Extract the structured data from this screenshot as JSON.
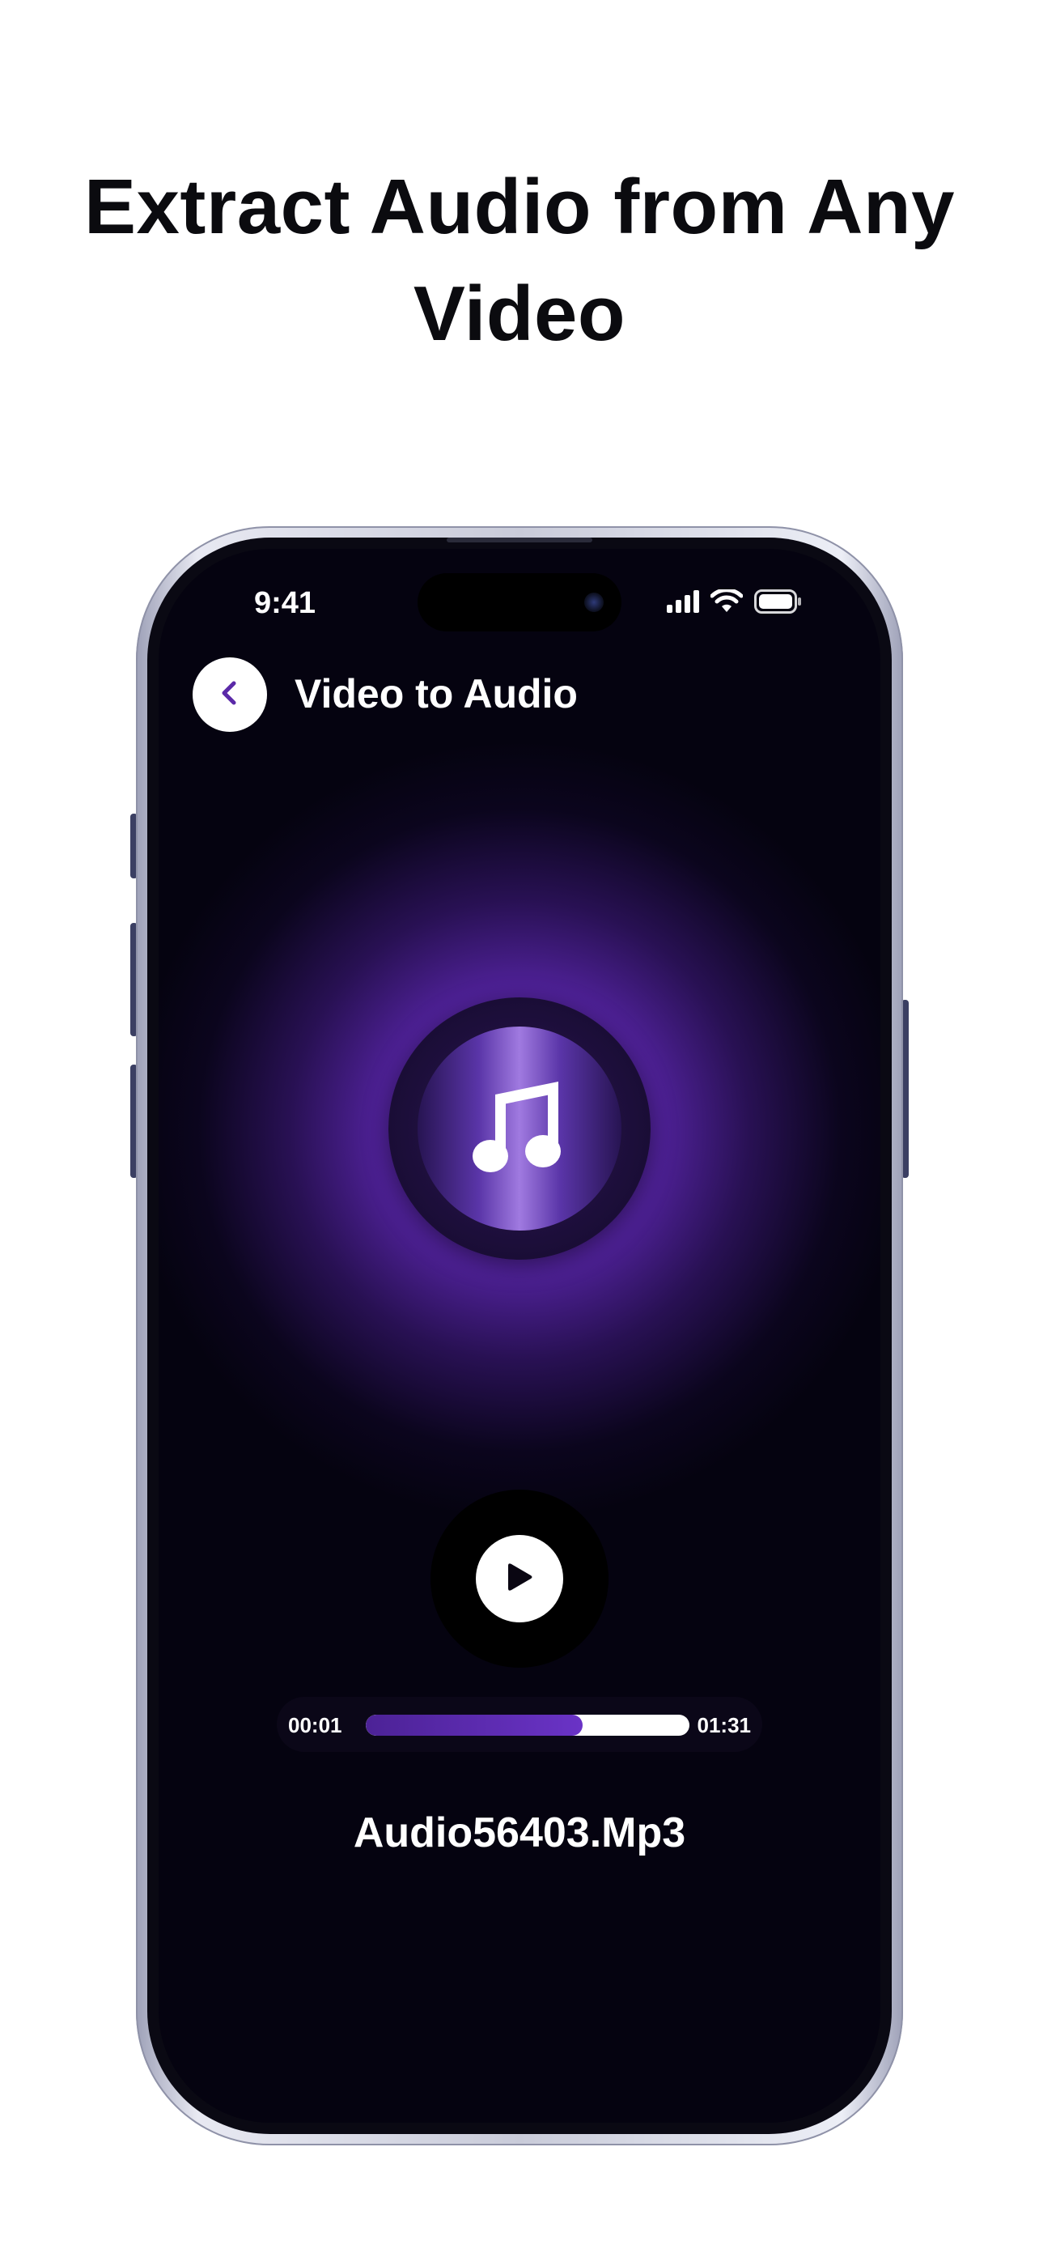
{
  "headline": {
    "line1": "Extract Audio from Any",
    "line2": "Video"
  },
  "status_bar": {
    "time": "9:41",
    "icons": [
      "signal-icon",
      "wifi-icon",
      "battery-icon"
    ]
  },
  "header": {
    "back_icon": "chevron-left-icon",
    "title": "Video to Audio"
  },
  "player": {
    "art_icon": "music-note-icon",
    "play_icon": "play-icon",
    "current_time": "00:01",
    "total_time": "01:31",
    "progress_fraction": 0.67,
    "file_name": "Audio56403.Mp3"
  },
  "colors": {
    "accent": "#6a33c6",
    "screen_bg": "#050310",
    "glow": "#7836d6"
  }
}
